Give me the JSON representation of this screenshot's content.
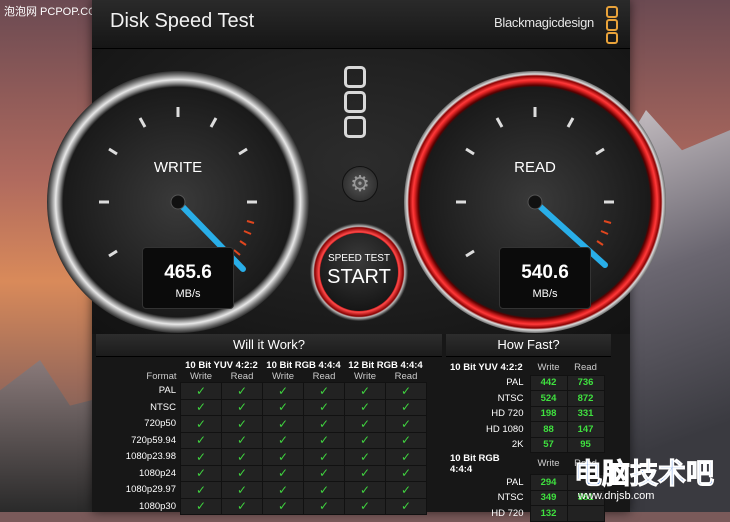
{
  "watermark": "泡泡网 PCPOP.COM",
  "window": {
    "title": "Disk Speed Test",
    "brand": "Blackmagicdesign"
  },
  "gauges": {
    "write": {
      "label": "WRITE",
      "value": "465.6",
      "unit": "MB/s"
    },
    "read": {
      "label": "READ",
      "value": "540.6",
      "unit": "MB/s"
    }
  },
  "start": {
    "small": "SPEED TEST",
    "big": "START"
  },
  "will_it_work": {
    "title": "Will it Work?",
    "format_label": "Format",
    "groups": [
      "10 Bit YUV 4:2:2",
      "10 Bit RGB 4:4:4",
      "12 Bit RGB 4:4:4"
    ],
    "sub": [
      "Write",
      "Read"
    ],
    "rows": [
      "PAL",
      "NTSC",
      "720p50",
      "720p59.94",
      "1080p23.98",
      "1080p24",
      "1080p29.97",
      "1080p30"
    ],
    "check": "✓"
  },
  "how_fast": {
    "title": "How Fast?",
    "sub": [
      "Write",
      "Read"
    ],
    "sections": [
      {
        "name": "10 Bit YUV 4:2:2",
        "rows": [
          {
            "label": "PAL",
            "write": "442",
            "read": "736"
          },
          {
            "label": "NTSC",
            "write": "524",
            "read": "872"
          },
          {
            "label": "HD 720",
            "write": "198",
            "read": "331"
          },
          {
            "label": "HD 1080",
            "write": "88",
            "read": "147"
          },
          {
            "label": "2K",
            "write": "57",
            "read": "95"
          }
        ]
      },
      {
        "name": "10 Bit RGB 4:4:4",
        "rows": [
          {
            "label": "PAL",
            "write": "294",
            "read": ""
          },
          {
            "label": "NTSC",
            "write": "349",
            "read": "581"
          },
          {
            "label": "HD 720",
            "write": "132",
            "read": ""
          }
        ]
      }
    ]
  },
  "footer_watermark": {
    "cn": "电脑技术吧",
    "url": "www.dnjsb.com"
  }
}
